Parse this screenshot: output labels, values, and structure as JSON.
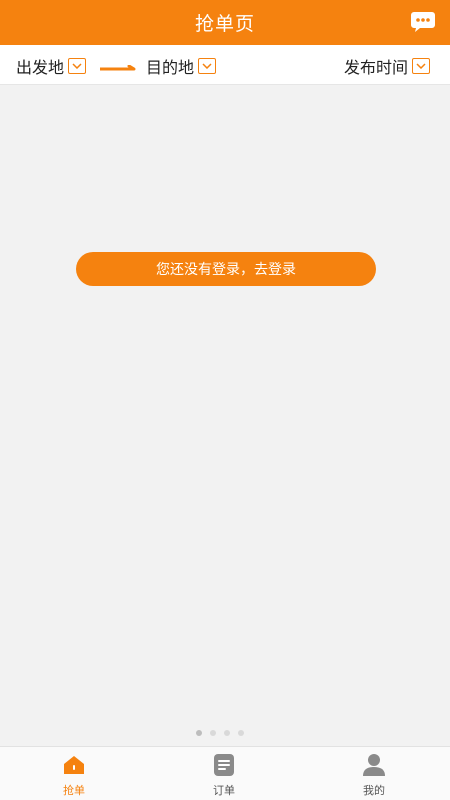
{
  "header": {
    "title": "抢单页",
    "chat_icon": "chat-bubble-icon"
  },
  "filters": {
    "origin_label": "出发地",
    "destination_label": "目的地",
    "publish_time_label": "发布时间"
  },
  "main": {
    "login_prompt": "您还没有登录，去登录"
  },
  "bottom_nav": {
    "items": [
      {
        "label": "抢单",
        "icon": "house-icon",
        "active": true
      },
      {
        "label": "订单",
        "icon": "order-list-icon",
        "active": false
      },
      {
        "label": "我的",
        "icon": "user-icon",
        "active": false
      }
    ]
  },
  "colors": {
    "accent": "#f5820f",
    "background": "#f2f2f2",
    "inactive_icon": "#8a8a8a"
  }
}
